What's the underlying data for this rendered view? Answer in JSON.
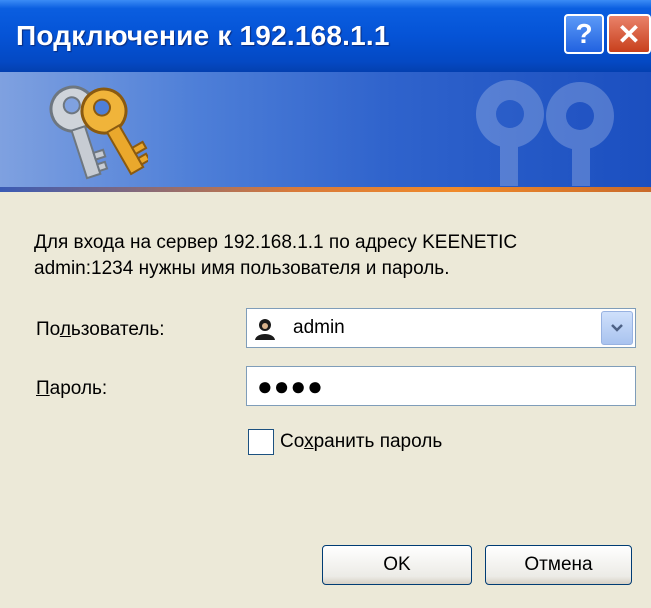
{
  "window": {
    "title": "Подключение к 192.168.1.1",
    "help_glyph": "?",
    "close_glyph": "✕"
  },
  "dialog": {
    "message_line1": "Для входа на сервер 192.168.1.1 по адресу KEENETIC",
    "message_line2": "admin:1234 нужны имя пользователя и пароль.",
    "user_label_pre": "По",
    "user_label_ul": "л",
    "user_label_post": "ьзователь:",
    "user_value": "admin",
    "pass_label_ul": "П",
    "pass_label_post": "ароль:",
    "pass_value": "●●●●",
    "save_label_pre": "Со",
    "save_label_ul": "х",
    "save_label_post": "ранить пароль",
    "save_checked": false,
    "ok_label": "OK",
    "cancel_label": "Отмена"
  },
  "icons": {
    "keys": "keys-icon",
    "user": "user-icon",
    "dropdown": "chevron-down-icon"
  },
  "colors": {
    "titlebar": "#0553d6",
    "dialog_bg": "#ece9d8",
    "close_button": "#c8401c"
  }
}
